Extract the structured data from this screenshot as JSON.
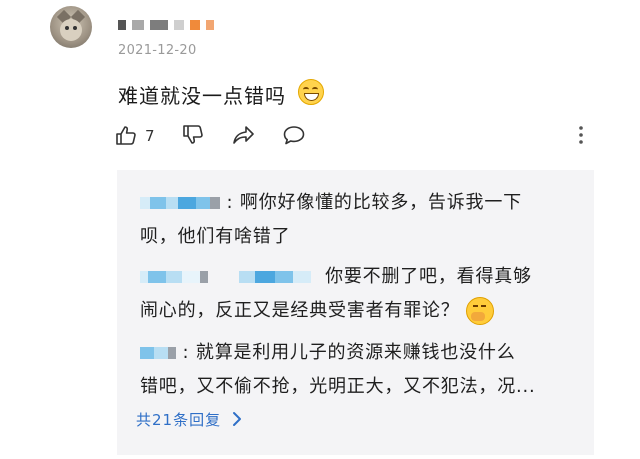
{
  "post": {
    "date": "2021-12-20",
    "comment_text": "难道就没一点错吗",
    "like_count": "7"
  },
  "icons": [
    "thumbs-up-icon",
    "thumbs-down-icon",
    "share-icon",
    "comment-bubble-icon",
    "more-options-icon",
    "laughing-emoji",
    "angry-emoji",
    "chevron-right-icon"
  ],
  "replies": [
    {
      "line1": ": 啊你好像懂的比较多，告诉我一下",
      "line2": "呗，他们有啥错了"
    },
    {
      "line1": "你要不删了吧，看得真够",
      "line2": "闹心的，反正又是经典受害者有罪论？"
    },
    {
      "line1": ": 就算是利用儿子的资源来赚钱也没什么",
      "line2": "错吧，又不偷不抢，光明正大，又不犯法，况..."
    }
  ],
  "more_replies_label": "共21条回复",
  "colors": {
    "link": "#2f6fc7",
    "reply_bg": "#f4f4f6",
    "blur_blue": "#7fc3ea",
    "blur_gray": "#9aa0a8",
    "blur_orange": "#f08a3a"
  }
}
